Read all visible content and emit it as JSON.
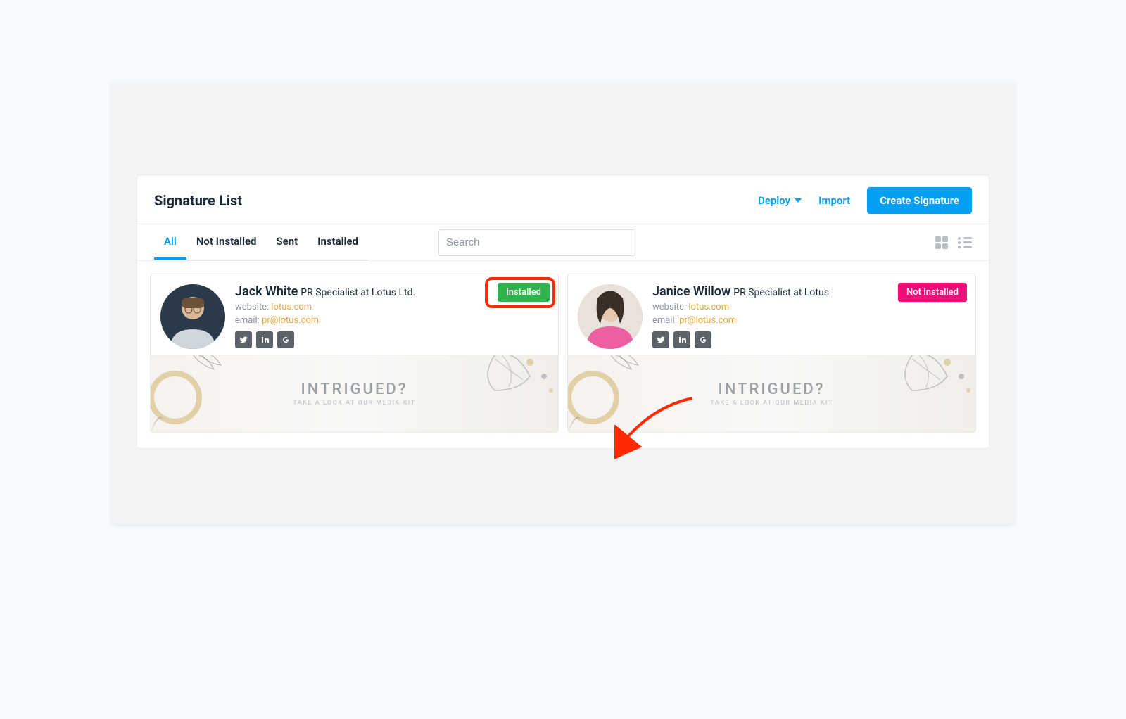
{
  "header": {
    "title": "Signature List",
    "deploy_label": "Deploy",
    "import_label": "Import",
    "create_label": "Create Signature"
  },
  "tabs": {
    "all": "All",
    "not_installed": "Not Installed",
    "sent": "Sent",
    "installed": "Installed"
  },
  "search": {
    "placeholder": "Search"
  },
  "cards": [
    {
      "name": "Jack White",
      "role": "PR Specialist at Lotus Ltd.",
      "website_label": "website:",
      "website": "lotus.com",
      "email_label": "email:",
      "email": "pr@lotus.com",
      "status_label": "Installed",
      "status": "installed",
      "banner_title": "INTRIGUED?",
      "banner_sub": "TAKE A LOOK AT OUR MEDIA KIT"
    },
    {
      "name": "Janice Willow",
      "role": "PR Specialist at Lotus",
      "website_label": "website:",
      "website": "lotus.com",
      "email_label": "email:",
      "email": "pr@lotus.com",
      "status_label": "Not Installed",
      "status": "not-installed",
      "banner_title": "INTRIGUED?",
      "banner_sub": "TAKE A LOOK AT OUR MEDIA KIT"
    }
  ],
  "colors": {
    "accent": "#049ef4",
    "installed": "#2fb24c",
    "not_installed": "#ec0f78",
    "highlight": "#ff2a00"
  }
}
